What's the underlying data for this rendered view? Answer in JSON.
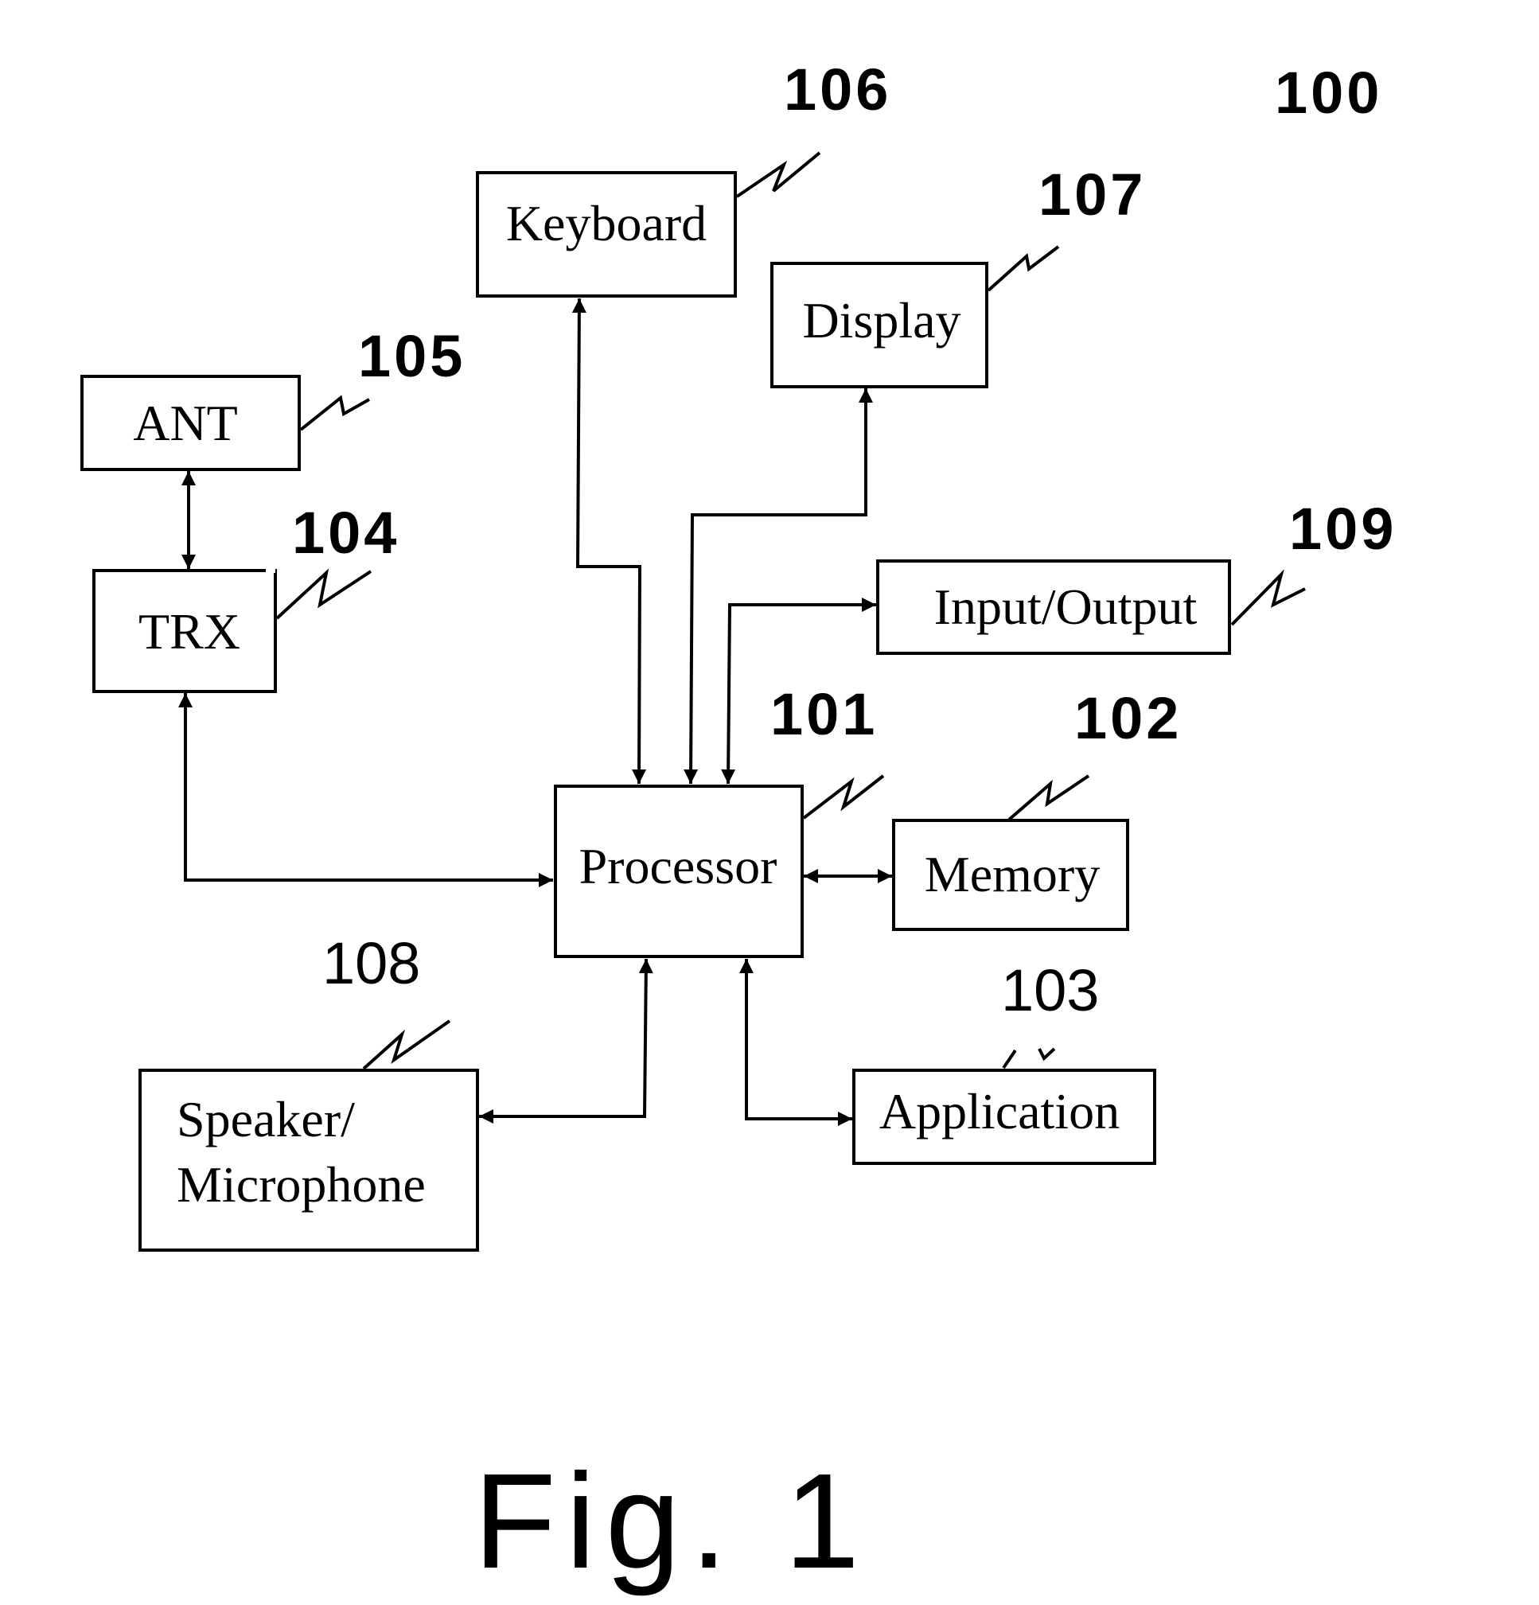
{
  "figure": {
    "caption": "Fig. 1",
    "device_ref": "100"
  },
  "blocks": {
    "processor": {
      "label": "Processor",
      "ref": "101"
    },
    "memory": {
      "label": "Memory",
      "ref": "102"
    },
    "application": {
      "label": "Application",
      "ref": "103"
    },
    "trx": {
      "label": "TRX",
      "ref": "104"
    },
    "ant": {
      "label": "ANT",
      "ref": "105"
    },
    "keyboard": {
      "label": "Keyboard",
      "ref": "106"
    },
    "display": {
      "label": "Display",
      "ref": "107"
    },
    "speaker": {
      "label_line1": "Speaker/",
      "label_line2": "Microphone",
      "ref": "108"
    },
    "io": {
      "label": "Input/Output",
      "ref": "109"
    }
  },
  "connections": [
    {
      "from": "ANT",
      "to": "TRX",
      "direction": "bidirectional"
    },
    {
      "from": "TRX",
      "to": "Processor",
      "direction": "bidirectional"
    },
    {
      "from": "Keyboard",
      "to": "Processor",
      "direction": "bidirectional"
    },
    {
      "from": "Processor",
      "to": "Display",
      "direction": "bidirectional"
    },
    {
      "from": "Processor",
      "to": "Input/Output",
      "direction": "bidirectional"
    },
    {
      "from": "Processor",
      "to": "Memory",
      "direction": "bidirectional"
    },
    {
      "from": "Processor",
      "to": "Application",
      "direction": "bidirectional"
    },
    {
      "from": "Processor",
      "to": "Speaker/Microphone",
      "direction": "bidirectional"
    }
  ]
}
